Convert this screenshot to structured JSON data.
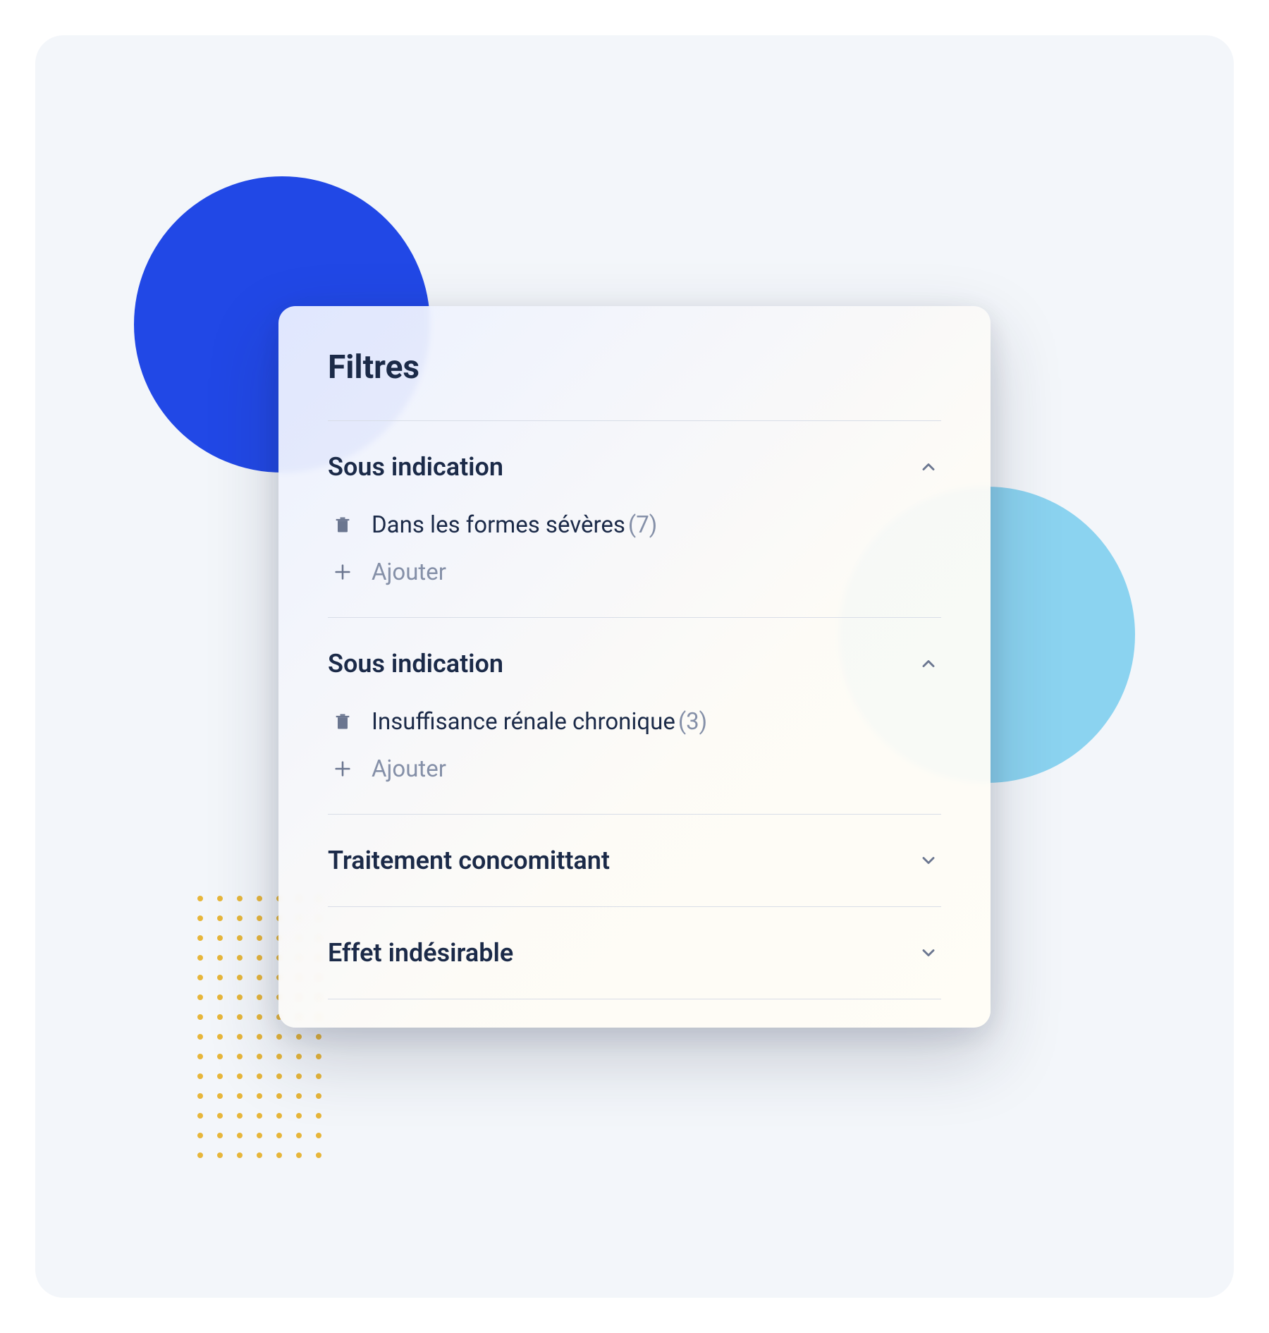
{
  "panel": {
    "title": "Filtres"
  },
  "sections": [
    {
      "title": "Sous indication",
      "expanded": true,
      "items": [
        {
          "label": "Dans les formes sévères",
          "count": "(7)"
        }
      ],
      "add_label": "Ajouter"
    },
    {
      "title": "Sous indication",
      "expanded": true,
      "items": [
        {
          "label": "Insuffisance rénale chronique",
          "count": "(3)"
        }
      ],
      "add_label": "Ajouter"
    },
    {
      "title": "Traitement concomittant",
      "expanded": false
    },
    {
      "title": "Effet indésirable",
      "expanded": false
    }
  ]
}
